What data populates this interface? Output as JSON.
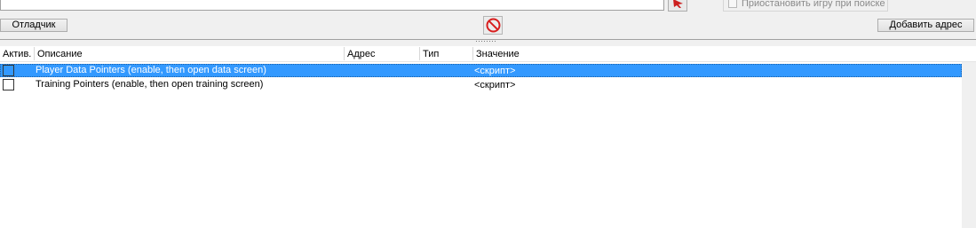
{
  "top": {
    "pause_label": "Приостановить игру при поиске",
    "debugger_label": "Отладчик",
    "add_address_label": "Добавить адрес"
  },
  "table": {
    "columns": {
      "active": "Актив.",
      "description": "Описание",
      "address": "Адрес",
      "type": "Тип",
      "value": "Значение"
    },
    "rows": [
      {
        "active": false,
        "description": "Player Data Pointers (enable, then open data screen)",
        "address": "",
        "type": "",
        "value": "<скрипт>",
        "selected": true
      },
      {
        "active": false,
        "description": "Training Pointers (enable, then open training screen)",
        "address": "",
        "type": "",
        "value": "<скрипт>",
        "selected": false
      }
    ]
  },
  "colors": {
    "selection": "#3399ff",
    "clear_icon": "#d81e1e",
    "pointer_icon": "#cc1f1f"
  },
  "icons": {
    "clear": "no-entry-icon",
    "pointer": "pointer-arrow-icon"
  }
}
